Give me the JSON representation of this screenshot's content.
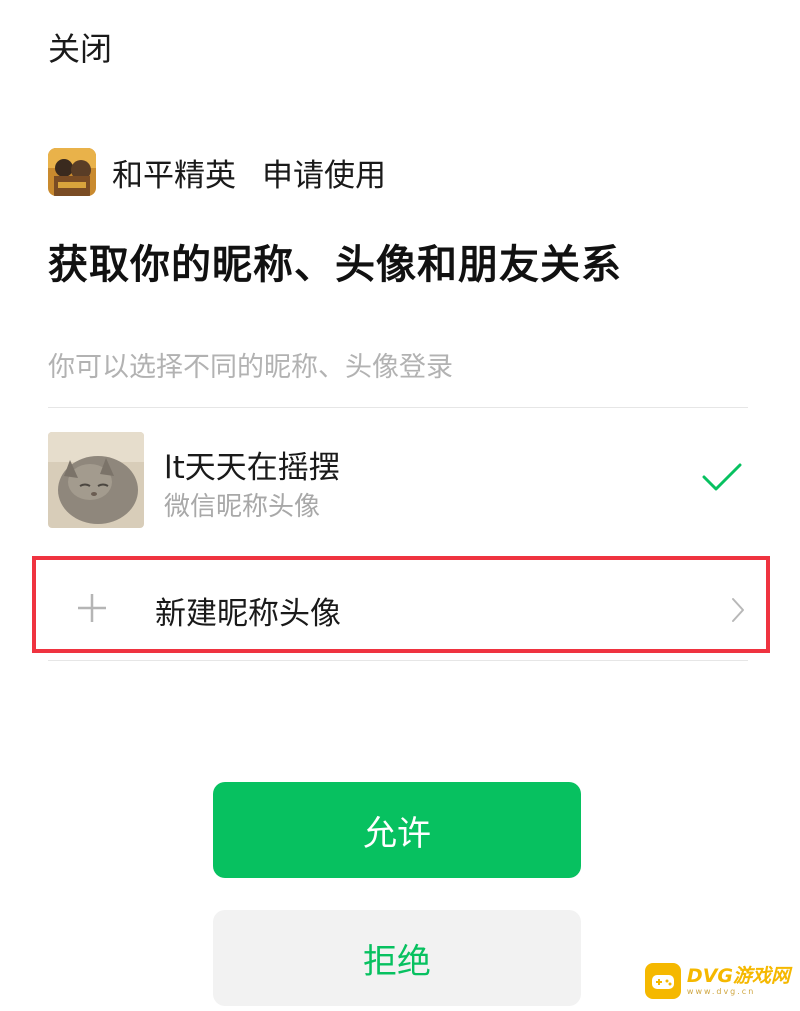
{
  "header": {
    "close_label": "关闭"
  },
  "app": {
    "name": "和平精英",
    "request_text": "申请使用"
  },
  "permission": {
    "title": "获取你的昵称、头像和朋友关系",
    "hint": "你可以选择不同的昵称、头像登录"
  },
  "profile": {
    "name": "lt天天在摇摆",
    "subtitle": "微信昵称头像",
    "selected": true
  },
  "new_profile": {
    "label": "新建昵称头像"
  },
  "actions": {
    "allow_label": "允许",
    "deny_label": "拒绝"
  },
  "watermark": {
    "brand": "DVG游戏网",
    "domain": "www.dvg.cn"
  },
  "icons": {
    "app_icon": "game-icon",
    "avatar": "cat-photo",
    "check": "check-icon",
    "plus": "plus-icon",
    "chevron": "chevron-right-icon"
  },
  "colors": {
    "accent": "#07c160",
    "highlight": "#ef3340",
    "deny_bg": "#f2f2f2",
    "watermark": "#f5b800"
  }
}
